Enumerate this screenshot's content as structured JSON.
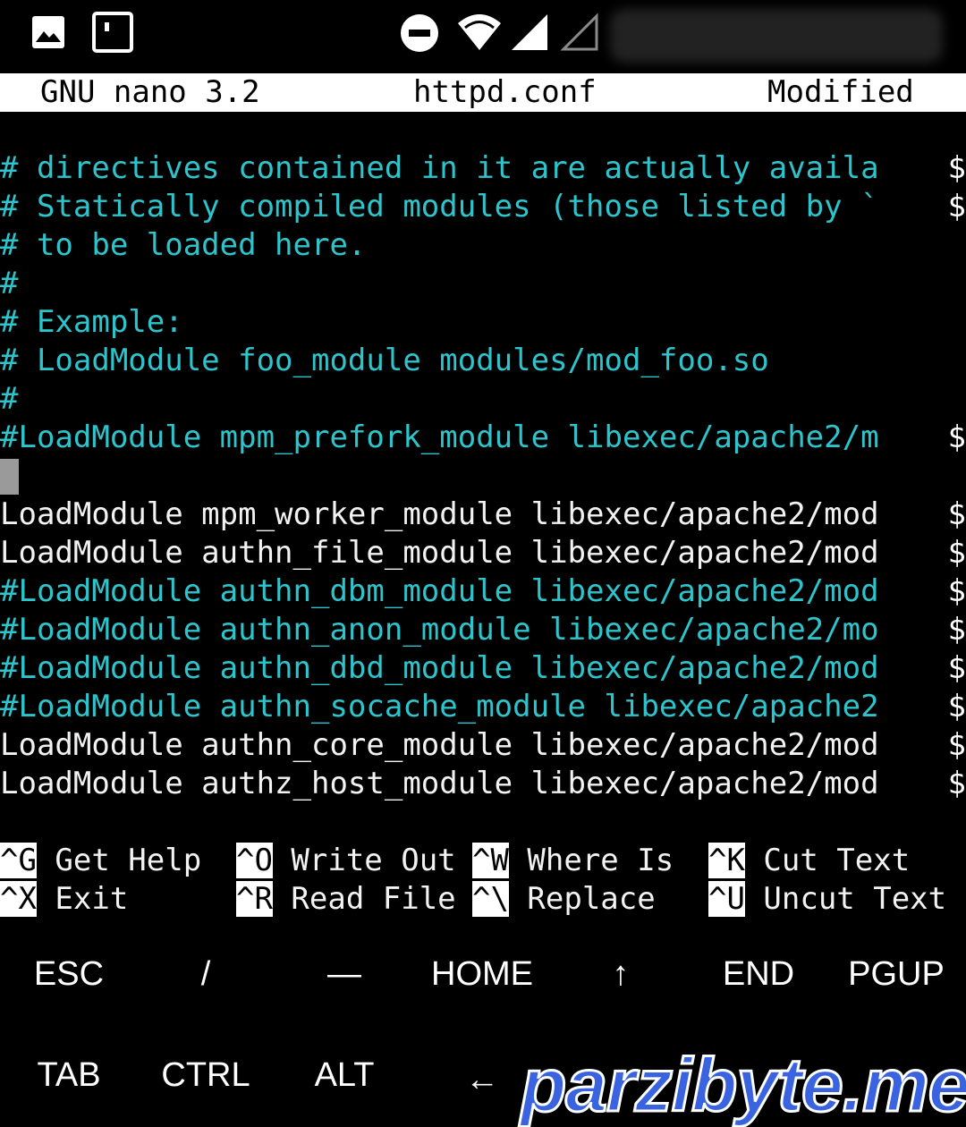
{
  "nano": {
    "app": "GNU nano 3.2",
    "file": "httpd.conf",
    "status": "Modified"
  },
  "lines": [
    {
      "text": "# directives contained in it are actually availa",
      "trunc": "$",
      "kind": "comment"
    },
    {
      "text": "# Statically compiled modules (those listed by `",
      "trunc": "$",
      "kind": "comment"
    },
    {
      "text": "# to be loaded here.",
      "trunc": "",
      "kind": "comment"
    },
    {
      "text": "#",
      "trunc": "",
      "kind": "comment"
    },
    {
      "text": "# Example:",
      "trunc": "",
      "kind": "comment"
    },
    {
      "text": "# LoadModule foo_module modules/mod_foo.so",
      "trunc": "",
      "kind": "comment"
    },
    {
      "text": "#",
      "trunc": "",
      "kind": "comment"
    },
    {
      "text": "#LoadModule mpm_prefork_module libexec/apache2/m",
      "trunc": "$",
      "kind": "comment"
    },
    {
      "text": "",
      "trunc": "",
      "kind": "code"
    },
    {
      "text": "LoadModule mpm_worker_module libexec/apache2/mod",
      "trunc": "$",
      "kind": "code"
    },
    {
      "text": "LoadModule authn_file_module libexec/apache2/mod",
      "trunc": "$",
      "kind": "code"
    },
    {
      "text": "#LoadModule authn_dbm_module libexec/apache2/mod",
      "trunc": "$",
      "kind": "comment"
    },
    {
      "text": "#LoadModule authn_anon_module libexec/apache2/mo",
      "trunc": "$",
      "kind": "comment"
    },
    {
      "text": "#LoadModule authn_dbd_module libexec/apache2/mod",
      "trunc": "$",
      "kind": "comment"
    },
    {
      "text": "#LoadModule authn_socache_module libexec/apache2",
      "trunc": "$",
      "kind": "comment"
    },
    {
      "text": "LoadModule authn_core_module libexec/apache2/mod",
      "trunc": "$",
      "kind": "code"
    },
    {
      "text": "LoadModule authz_host_module libexec/apache2/mod",
      "trunc": "$",
      "kind": "code"
    }
  ],
  "shortcuts": {
    "get_help": {
      "key": "^G",
      "label": " Get Help "
    },
    "exit": {
      "key": "^X",
      "label": " Exit"
    },
    "write_out": {
      "key": "^O",
      "label": " Write Out"
    },
    "read_file": {
      "key": "^R",
      "label": " Read File"
    },
    "where_is": {
      "key": "^W",
      "label": " Where Is "
    },
    "replace": {
      "key": "^\\",
      "label": " Replace"
    },
    "cut_text": {
      "key": "^K",
      "label": " Cut Text"
    },
    "uncut_text": {
      "key": "^U",
      "label": " Uncut Text"
    }
  },
  "extra_keys": {
    "esc": "ESC",
    "slash": "/",
    "dash": "—",
    "home": "HOME",
    "up": "↑",
    "end": "END",
    "pgup": "PGUP",
    "tab": "TAB",
    "ctrl": "CTRL",
    "alt": "ALT",
    "left": "←"
  },
  "watermark": "parzibyte.me",
  "colors": {
    "comment": "#2ec4cc",
    "text": "#f2f2f2",
    "background": "#000000",
    "watermark": "#3a63e0"
  }
}
